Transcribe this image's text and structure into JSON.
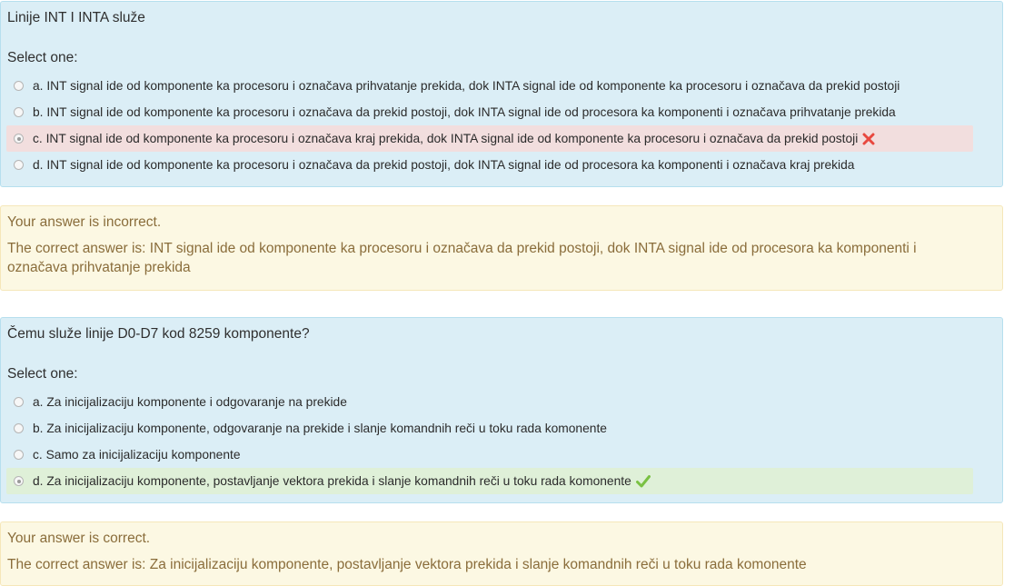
{
  "q1": {
    "question": "Linije INT I INTA služe",
    "prompt": "Select one:",
    "answers": [
      {
        "label": "a. INT signal ide od komponente ka procesoru i označava prihvatanje prekida, dok INTA signal ide od komponente ka procesoru i označava da prekid postoji",
        "selected": false,
        "state": "none"
      },
      {
        "label": "b. INT signal ide od komponente ka procesoru i označava da prekid postoji, dok INTA signal ide od procesora ka komponenti i označava prihvatanje prekida",
        "selected": false,
        "state": "none"
      },
      {
        "label": "c. INT signal ide od komponente ka procesoru i označava kraj prekida, dok INTA signal ide od komponente ka procesoru i označava da prekid postoji",
        "selected": true,
        "state": "incorrect",
        "icon": "cross-icon"
      },
      {
        "label": "d. INT signal ide od komponente ka procesoru i označava da prekid postoji, dok INTA signal ide od procesora ka komponenti i označava kraj prekida",
        "selected": false,
        "state": "none"
      }
    ]
  },
  "f1": {
    "status": "Your answer is incorrect.",
    "right_answer": "The correct answer is: INT signal ide od komponente ka procesoru i označava da prekid postoji, dok INTA signal ide od procesora ka komponenti i označava prihvatanje prekida"
  },
  "q2": {
    "question": "Čemu služe linije D0-D7 kod 8259 komponente?",
    "prompt": "Select one:",
    "answers": [
      {
        "label": "a. Za inicijalizaciju komponente i odgovaranje na prekide",
        "selected": false,
        "state": "none"
      },
      {
        "label": "b. Za inicijalizaciju komponente, odgovaranje na prekide i slanje komandnih reči u toku rada komonente",
        "selected": false,
        "state": "none"
      },
      {
        "label": "c. Samo za inicijalizaciju komponente",
        "selected": false,
        "state": "none"
      },
      {
        "label": "d. Za inicijalizaciju komponente, postavljanje vektora prekida i slanje komandnih reči u toku rada komonente",
        "selected": true,
        "state": "correct",
        "icon": "check-icon"
      }
    ]
  },
  "f2": {
    "status": "Your answer is correct.",
    "right_answer": "The correct answer is: Za inicijalizaciju komponente, postavljanje vektora prekida i slanje komandnih reči u toku rada komonente"
  },
  "colors": {
    "question_bg": "#dbeef6",
    "feedback_bg": "#fcf8e3",
    "incorrect_bg": "#f2dede",
    "correct_bg": "#dff0d8",
    "cross": "#e8483f",
    "check": "#7ac143"
  }
}
